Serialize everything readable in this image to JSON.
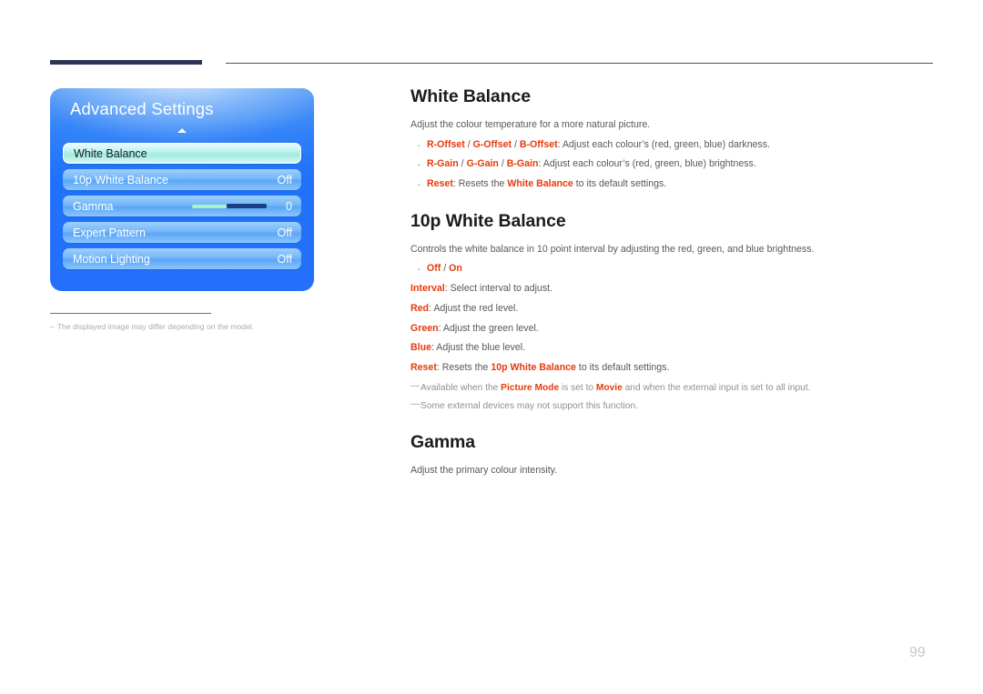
{
  "page": {
    "number": "99"
  },
  "figure": {
    "osd": {
      "title": "Advanced Settings",
      "scroll_indicator": "up-arrow",
      "rows": [
        {
          "label": "White Balance",
          "value": "",
          "selected": true,
          "type": "item"
        },
        {
          "label": "10p White Balance",
          "value": "Off",
          "selected": false,
          "type": "item"
        },
        {
          "label": "Gamma",
          "value": "0",
          "selected": false,
          "type": "slider"
        },
        {
          "label": "Expert Pattern",
          "value": "Off",
          "selected": false,
          "type": "item"
        },
        {
          "label": "Motion Lighting",
          "value": "Off",
          "selected": false,
          "type": "item"
        }
      ]
    },
    "note": {
      "dash": "–",
      "text": "The displayed image may differ depending on the model."
    }
  },
  "sections": {
    "white_balance": {
      "title": "White Balance",
      "intro": "Adjust the colour temperature for a more natural picture.",
      "bullets": [
        {
          "parts": [
            {
              "text": "R-Offset",
              "style": "kw"
            },
            {
              "text": " / ",
              "style": "plain"
            },
            {
              "text": "G-Offset",
              "style": "kw"
            },
            {
              "text": " / ",
              "style": "plain"
            },
            {
              "text": "B-Offset",
              "style": "kw"
            },
            {
              "text": ": Adjust each colour’s (red, green, blue) darkness.",
              "style": "plain"
            }
          ]
        },
        {
          "parts": [
            {
              "text": "R-Gain",
              "style": "kw"
            },
            {
              "text": " / ",
              "style": "plain"
            },
            {
              "text": "G-Gain",
              "style": "kw"
            },
            {
              "text": " / ",
              "style": "plain"
            },
            {
              "text": "B-Gain",
              "style": "kw"
            },
            {
              "text": ": Adjust each colour’s (red, green, blue) brightness.",
              "style": "plain"
            }
          ]
        },
        {
          "parts": [
            {
              "text": "Reset",
              "style": "kw"
            },
            {
              "text": ": Resets the ",
              "style": "plain"
            },
            {
              "text": "White Balance",
              "style": "kw"
            },
            {
              "text": " to its default settings.",
              "style": "plain"
            }
          ]
        }
      ]
    },
    "tenp_white_balance": {
      "title": "10p White Balance",
      "intro": "Controls the white balance in 10 point interval by adjusting the red, green, and blue brightness.",
      "bullets": [
        {
          "parts": [
            {
              "text": "Off",
              "style": "kw"
            },
            {
              "text": " / ",
              "style": "plain"
            },
            {
              "text": "On",
              "style": "kw"
            }
          ]
        }
      ],
      "lines": [
        {
          "parts": [
            {
              "text": "Interval",
              "style": "kw"
            },
            {
              "text": ": Select interval to adjust.",
              "style": "plain"
            }
          ]
        },
        {
          "parts": [
            {
              "text": "Red",
              "style": "kw"
            },
            {
              "text": ": Adjust the red level.",
              "style": "plain"
            }
          ]
        },
        {
          "parts": [
            {
              "text": "Green",
              "style": "kw"
            },
            {
              "text": ": Adjust the green level.",
              "style": "plain"
            }
          ]
        },
        {
          "parts": [
            {
              "text": "Blue",
              "style": "kw"
            },
            {
              "text": ": Adjust the blue level.",
              "style": "plain"
            }
          ]
        },
        {
          "parts": [
            {
              "text": "Reset",
              "style": "kw"
            },
            {
              "text": ": Resets the ",
              "style": "plain"
            },
            {
              "text": "10p White Balance",
              "style": "kw"
            },
            {
              "text": " to its default settings.",
              "style": "plain"
            }
          ]
        }
      ],
      "notes": [
        {
          "mark": "—",
          "parts": [
            {
              "text": "Available when the ",
              "style": "plain"
            },
            {
              "text": "Picture Mode",
              "style": "kw"
            },
            {
              "text": " is set to ",
              "style": "plain"
            },
            {
              "text": "Movie",
              "style": "kw"
            },
            {
              "text": " and when the external input is set to all input.",
              "style": "plain"
            }
          ]
        },
        {
          "mark": "—",
          "parts": [
            {
              "text": "Some external devices may not support this function.",
              "style": "plain"
            }
          ]
        }
      ]
    },
    "gamma": {
      "title": "Gamma",
      "intro": "Adjust the primary colour intensity."
    }
  },
  "colors": {
    "keyword_red": "#e8390c",
    "heading": "#1c1c1c",
    "body": "#58585a",
    "note": "#8f9096",
    "rule_navy": "#2e3355",
    "osd_blue": "#2071fb",
    "osd_selected": "#bdf3ef",
    "slider_filled": "#a6f4c5",
    "slider_rest": "#1a3f84",
    "page_number": "#c9c9cc"
  }
}
